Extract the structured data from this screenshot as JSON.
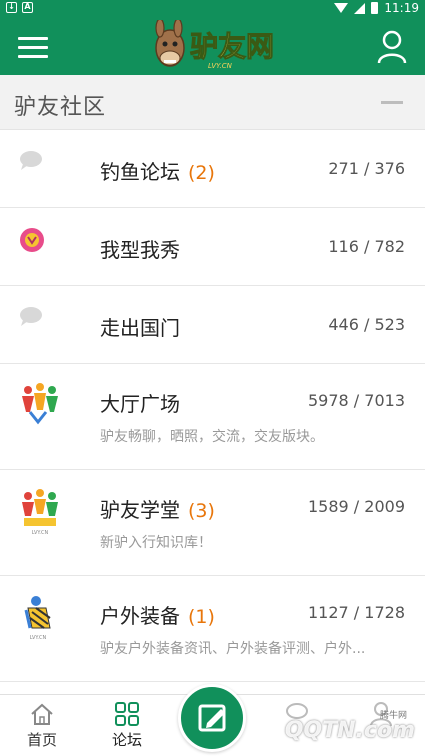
{
  "status_bar": {
    "time": "11:19"
  },
  "app_bar": {
    "logo_text": "驴友网",
    "logo_sub": "LVY.CN"
  },
  "section": {
    "title": "驴友社区"
  },
  "forums": [
    {
      "name": "钓鱼论坛",
      "badge": "(2)",
      "count": "271 / 376",
      "desc": "",
      "icon": "chat-bubble-icon"
    },
    {
      "name": "我型我秀",
      "badge": "",
      "count": "116 / 782",
      "desc": "",
      "icon": "pink-badge-icon"
    },
    {
      "name": "走出国门",
      "badge": "",
      "count": "446 / 523",
      "desc": "",
      "icon": "chat-bubble-icon"
    },
    {
      "name": "大厅广场",
      "badge": "",
      "count": "5978 / 7013",
      "desc": "驴友畅聊，晒照，交流，交友版块。",
      "icon": "people-group-icon"
    },
    {
      "name": "驴友学堂",
      "badge": "(3)",
      "count": "1589 / 2009",
      "desc": "新驴入行知识库！",
      "icon": "people-group-icon"
    },
    {
      "name": "户外装备",
      "badge": "(1)",
      "count": "1127 / 1728",
      "desc": "驴友户外装备资讯、户外装备评测、户外...",
      "icon": "outdoor-gear-icon"
    }
  ],
  "bottom_nav": {
    "items": [
      {
        "label": "首页",
        "icon": "home-icon"
      },
      {
        "label": "论坛",
        "icon": "grid-icon"
      }
    ]
  },
  "watermark": {
    "text": "QQTN.com",
    "small": "腾牛网"
  },
  "colors": {
    "primary": "#11905b",
    "accent": "#e8760b"
  }
}
